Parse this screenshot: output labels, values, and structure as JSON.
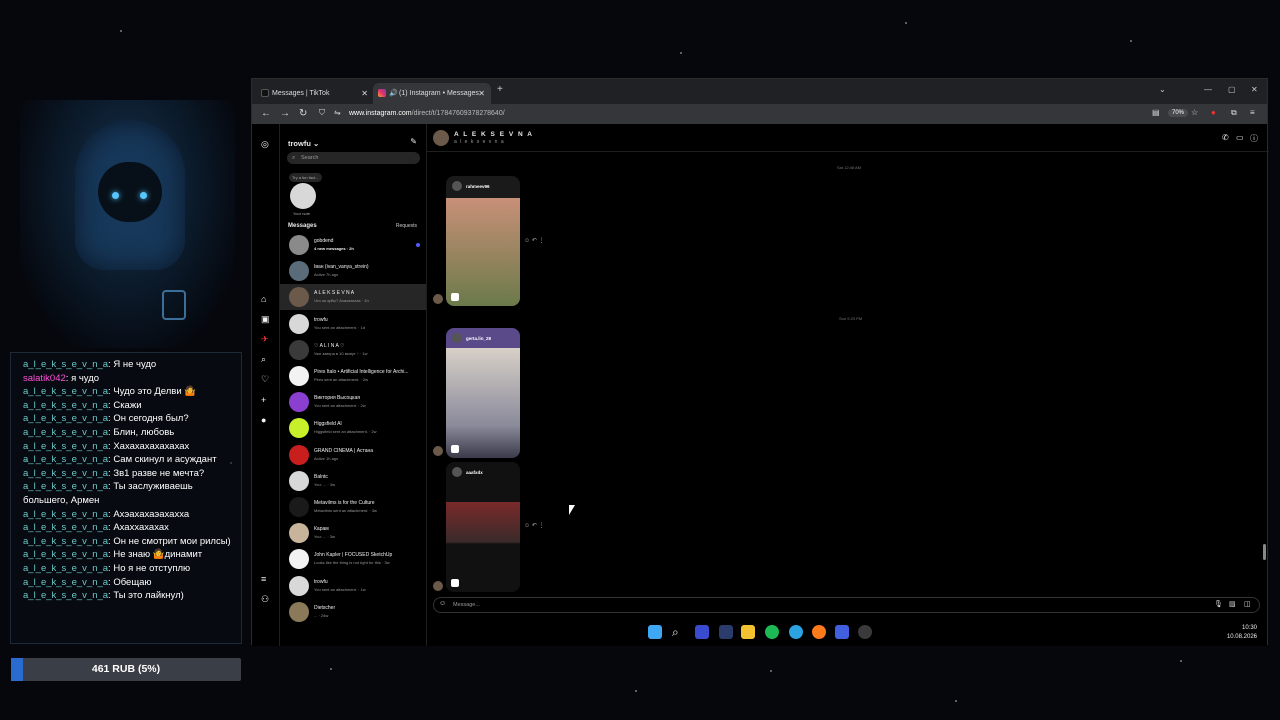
{
  "stream_chat": [
    {
      "user": "a_l_e_k_s_e_v_n_a",
      "msg": "Я не чудо",
      "pink": false
    },
    {
      "user": "salatik042",
      "msg": "я чудо",
      "pink": true
    },
    {
      "user": "a_l_e_k_s_e_v_n_a",
      "msg": "Чудо это Делви 🤷",
      "pink": false
    },
    {
      "user": "a_l_e_k_s_e_v_n_a",
      "msg": "Скажи",
      "pink": false
    },
    {
      "user": "a_l_e_k_s_e_v_n_a",
      "msg": "Он сегодня был?",
      "pink": false
    },
    {
      "user": "a_l_e_k_s_e_v_n_a",
      "msg": "Блин, любовь",
      "pink": false
    },
    {
      "user": "a_l_e_k_s_e_v_n_a",
      "msg": "Хахахахахахахах",
      "pink": false
    },
    {
      "user": "a_l_e_k_s_e_v_n_a",
      "msg": "Сам скинул и асуждант",
      "pink": false
    },
    {
      "user": "a_l_e_k_s_e_v_n_a",
      "msg": "Зв1 разве не мечта?",
      "pink": false
    },
    {
      "user": "a_l_e_k_s_e_v_n_a",
      "msg": "Ты заслуживаешь большего, Армен",
      "pink": false
    },
    {
      "user": "a_l_e_k_s_e_v_n_a",
      "msg": "Ахэахахаэахахха",
      "pink": false
    },
    {
      "user": "a_l_e_k_s_e_v_n_a",
      "msg": "Ахаххахахах",
      "pink": false
    },
    {
      "user": "a_l_e_k_s_e_v_n_a",
      "msg": "Он не смотрит мои рилсы)",
      "pink": false
    },
    {
      "user": "a_l_e_k_s_e_v_n_a",
      "msg": "Не знаю 🤷динамит",
      "pink": false
    },
    {
      "user": "a_l_e_k_s_e_v_n_a",
      "msg": "Но я не отступлю",
      "pink": false
    },
    {
      "user": "a_l_e_k_s_e_v_n_a",
      "msg": "Обещаю",
      "pink": false
    },
    {
      "user": "a_l_e_k_s_e_v_n_a",
      "msg": "Ты это лайкнул)",
      "pink": false
    }
  ],
  "donation": {
    "label": "461 RUB (5%)",
    "progress": 0.05
  },
  "browser": {
    "tabs": [
      {
        "label": "Messages | TikTok",
        "active": false
      },
      {
        "label": "(1) Instagram • Messages",
        "active": true
      }
    ],
    "url_host": "www.instagram.com",
    "url_path": "/direct/t/17847609378278640/",
    "zoom": "70%"
  },
  "instagram": {
    "username": "trowfu",
    "search_placeholder": "Search",
    "note_bubble": "Try a fun fact...",
    "your_note": "Your note",
    "messages_header": "Messages",
    "requests": "Requests",
    "conversations": [
      {
        "name": "gobdend",
        "sub": "4 new messages · 2h",
        "unread": true,
        "color": "#8a8a8a"
      },
      {
        "name": "Іван (ivan_vanya_strein)",
        "sub": "Active 7h ago",
        "unread": false,
        "color": "#5a6b7a"
      },
      {
        "name": "A L E K S E V N A",
        "sub": "Что за зубы? Ахахахахах · 1h",
        "unread": false,
        "color": "#6b5a4a",
        "selected": true
      },
      {
        "name": "trowfu",
        "sub": "You sent an attachment. · 1d",
        "unread": false,
        "color": "#d8d8d8"
      },
      {
        "name": "♡ A L I N A ♡",
        "sub": "Уже завтра в 10 минут ↑ · 1w",
        "unread": false,
        "color": "#3a3a3a"
      },
      {
        "name": "Pires Italo • Artificial Intelligence for Archi...",
        "sub": "Pires sent an attachment. · 2w",
        "unread": false,
        "color": "#f2f2f2"
      },
      {
        "name": "Виктория Высоцкая",
        "sub": "You sent an attachment. · 2w",
        "unread": false,
        "color": "#8b3fd0"
      },
      {
        "name": "Higgsfield AI",
        "sub": "Higgsfield sent an attachment. · 2w",
        "unread": false,
        "color": "#c8f02a"
      },
      {
        "name": "GRAND CINEMA | Астана",
        "sub": "Active 1h ago",
        "unread": false,
        "color": "#c81e1e"
      },
      {
        "name": "Balntc",
        "sub": "You: ... · 3w",
        "unread": false,
        "color": "#d8d8d8"
      },
      {
        "name": "Metavilms is for the Culture",
        "sub": "Metavilms sent an attachment. · 3w",
        "unread": false,
        "color": "#1a1a1a"
      },
      {
        "name": "Карам",
        "sub": "You: ... · 3w",
        "unread": false,
        "color": "#c8b49a"
      },
      {
        "name": "John Kapler | FOCUSED SketchUp",
        "sub": "Looks like the thing is not right for this · 3w",
        "unread": false,
        "color": "#f2f2f2"
      },
      {
        "name": "trowfu",
        "sub": "You sent an attachment. · 1w",
        "unread": false,
        "color": "#d8d8d8"
      },
      {
        "name": "Dietscher",
        "sub": "... · 24w",
        "unread": false,
        "color": "#8a7a5a"
      }
    ],
    "thread": {
      "name": "A L E K S E V N A",
      "handle": "a l e k s e v n a",
      "timestamps": [
        "Sat 12:46 AM",
        "Sun 9:23 PM"
      ],
      "reels": [
        {
          "user": "rahmeev96",
          "bg": "#c89078"
        },
        {
          "user": "gerta.lin_28",
          "bg": "#8a7a6a"
        },
        {
          "user": "aaafxdx",
          "bg": "#1a1a1a"
        }
      ],
      "composer_placeholder": "Message..."
    }
  },
  "clock": {
    "time": "10:30",
    "date": "10.08.2026"
  }
}
